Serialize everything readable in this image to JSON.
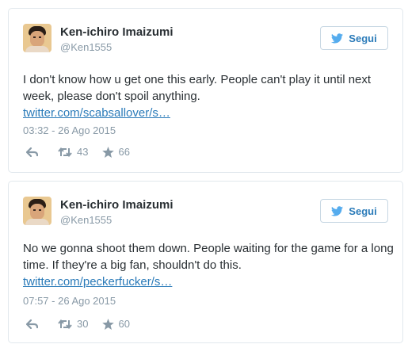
{
  "tweets": [
    {
      "name": "Ken-ichiro Imaizumi",
      "handle": "@Ken1555",
      "follow_label": "Segui",
      "text": "I don't know how u get one this early. People can't play it until next week, please don't spoil anything.",
      "link": "twitter.com/scabsallover/s…",
      "timestamp": "03:32 - 26 Ago 2015",
      "retweets": "43",
      "favorites": "66"
    },
    {
      "name": "Ken-ichiro Imaizumi",
      "handle": "@Ken1555",
      "follow_label": "Segui",
      "text": "No we gonna shoot them down. People waiting for the game for a long time. If they're a big fan, shouldn't do this.",
      "link": "twitter.com/peckerfucker/s…",
      "timestamp": "07:57 - 26 Ago 2015",
      "retweets": "30",
      "favorites": "60"
    }
  ],
  "colors": {
    "link": "#2b7bb9",
    "text": "#292f33",
    "muted": "#8899a6",
    "border": "#e1e8ed"
  },
  "icons": [
    "twitter-bird-icon",
    "reply-icon",
    "retweet-icon",
    "star-icon"
  ]
}
